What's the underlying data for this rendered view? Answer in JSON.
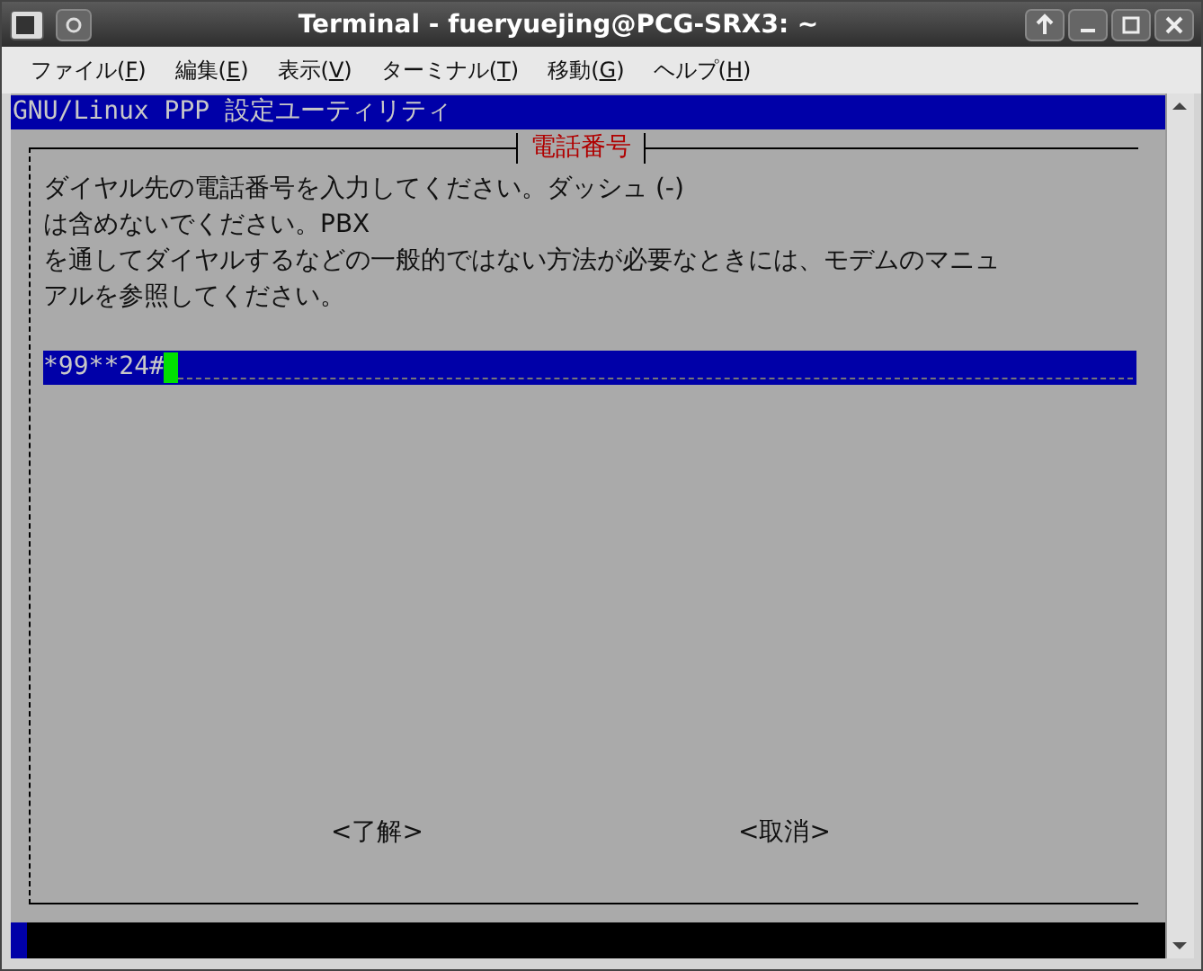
{
  "window": {
    "title": "Terminal - fueryuejing@PCG-SRX3: ~"
  },
  "menu": [
    {
      "before": "ファイル(",
      "key": "F",
      "after": ")"
    },
    {
      "before": "編集(",
      "key": "E",
      "after": ")"
    },
    {
      "before": "表示(",
      "key": "V",
      "after": ")"
    },
    {
      "before": "ターミナル(",
      "key": "T",
      "after": ")"
    },
    {
      "before": "移動(",
      "key": "G",
      "after": ")"
    },
    {
      "before": "ヘルプ(",
      "key": "H",
      "after": ")"
    }
  ],
  "screen": {
    "header": "GNU/Linux PPP 設定ユーティリティ",
    "dialog": {
      "title": "電話番号",
      "lines": [
        "ダイヤル先の電話番号を入力してください。ダッシュ (-)",
        "は含めないでください。PBX",
        "を通してダイヤルするなどの一般的ではない方法が必要なときには、モデムのマニュ",
        "アルを参照してください。"
      ],
      "input": {
        "value": "*99**24#"
      },
      "buttons": [
        {
          "label": "<了解>"
        },
        {
          "label": "<取消>"
        }
      ]
    }
  }
}
